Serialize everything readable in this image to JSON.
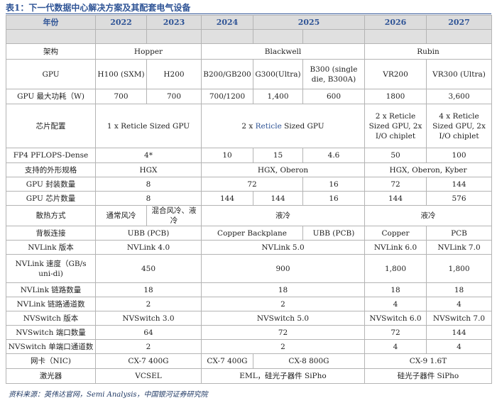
{
  "title": "表1：下一代数据中心解决方案及其配套电气设备",
  "source": "资料来源：英伟达官网，Semi Analysis，中国银河证券研究院",
  "header": [
    "年份",
    "2022",
    "2023",
    "2024",
    "2025",
    "2026",
    "2027"
  ],
  "rows": {
    "arch": {
      "label": "架构",
      "hopper": "Hopper",
      "blackwell": "Blackwell",
      "rubin": "Rubin"
    },
    "gpu": {
      "label": "GPU",
      "h100": "H100 (SXM)",
      "h200": "H200",
      "b200": "B200/GB200",
      "g300": "G300(Ultra)",
      "b300": "B300 (single die, B300A)",
      "vr200": "VR200",
      "vr300": "VR300 (Ultra)"
    },
    "power": {
      "label": "GPU 最大功耗（W)",
      "v1": "700",
      "v2": "700",
      "v3": "700/1200",
      "v4": "1,400",
      "v5": "600",
      "v6": "1800",
      "v7": "3,600"
    },
    "chip": {
      "label": "芯片配置",
      "v1": "1 x Reticle Sized GPU",
      "v2_pre": "2 x ",
      "v2_hl": "Reticle",
      "v2_post": " Sized GPU",
      "v3": "2 x Reticle Sized GPU, 2x I/O chiplet",
      "v4": "4 x Reticle Sized GPU, 2x I/O chiplet"
    },
    "fp4": {
      "label": "FP4 PFLOPS-Dense",
      "v1": "4*",
      "v2": "10",
      "v3": "15",
      "v4": "4.6",
      "v5": "50",
      "v6": "100"
    },
    "form": {
      "label": "支持的外形规格",
      "v1": "HGX",
      "v2": "HGX, Oberon",
      "v3": "HGX, Oberon, Kyber"
    },
    "pkg": {
      "label": "GPU  封装数量",
      "v1": "8",
      "v2": "72",
      "v3": "16",
      "v4": "72",
      "v5": "144"
    },
    "chips": {
      "label": "GPU  芯片数量",
      "v1": "8",
      "v2": "144",
      "v3": "144",
      "v4": "16",
      "v5": "144",
      "v6": "576"
    },
    "cool": {
      "label": "散热方式",
      "v1": "通常风冷",
      "v2": "混合风冷、液冷",
      "v3": "液冷",
      "v4": "液冷"
    },
    "back": {
      "label": "背板连接",
      "v1": "UBB (PCB)",
      "v2": "Copper Backplane",
      "v3": "UBB (PCB)",
      "v4": "Copper",
      "v5": "PCB"
    },
    "nvlv": {
      "label": "NVLink  版本",
      "v1": "NVLink 4.0",
      "v2": "NVLink 5.0",
      "v3": "NVLink 6.0",
      "v4": "NVLink 7.0"
    },
    "nvls": {
      "label": "NVLink  速度（GB/s uni-di)",
      "v1": "450",
      "v2": "900",
      "v3": "1,800",
      "v4": "1,800"
    },
    "nvll": {
      "label": "NVLink  链路数量",
      "v1": "18",
      "v2": "18",
      "v3": "18",
      "v4": "18"
    },
    "nvlc": {
      "label": "NVLink  链路通道数",
      "v1": "2",
      "v2": "2",
      "v3": "4",
      "v4": "4"
    },
    "nvsv": {
      "label": "NVSwitch  版本",
      "v1": "NVSwitch 3.0",
      "v2": "NVSwitch 5.0",
      "v3": "NVSwitch 6.0",
      "v4": "NVSwitch 7.0"
    },
    "nvsp": {
      "label": "NVSwitch  端口数量",
      "v1": "64",
      "v2": "72",
      "v3": "72",
      "v4": "144"
    },
    "nvsc": {
      "label": "NVSwitch  单端口通道数",
      "v1": "2",
      "v2": "2",
      "v3": "4",
      "v4": "4"
    },
    "nic": {
      "label": "网卡（NIC)",
      "v1": "CX-7 400G",
      "v2": "CX-7 400G",
      "v3": "CX-8 800G",
      "v4": "CX-9 1.6T"
    },
    "laser": {
      "label": "激光器",
      "v1": "VCSEL",
      "v2": "EML，硅光子器件 SiPho",
      "v3": "硅光子器件 SiPho"
    }
  }
}
